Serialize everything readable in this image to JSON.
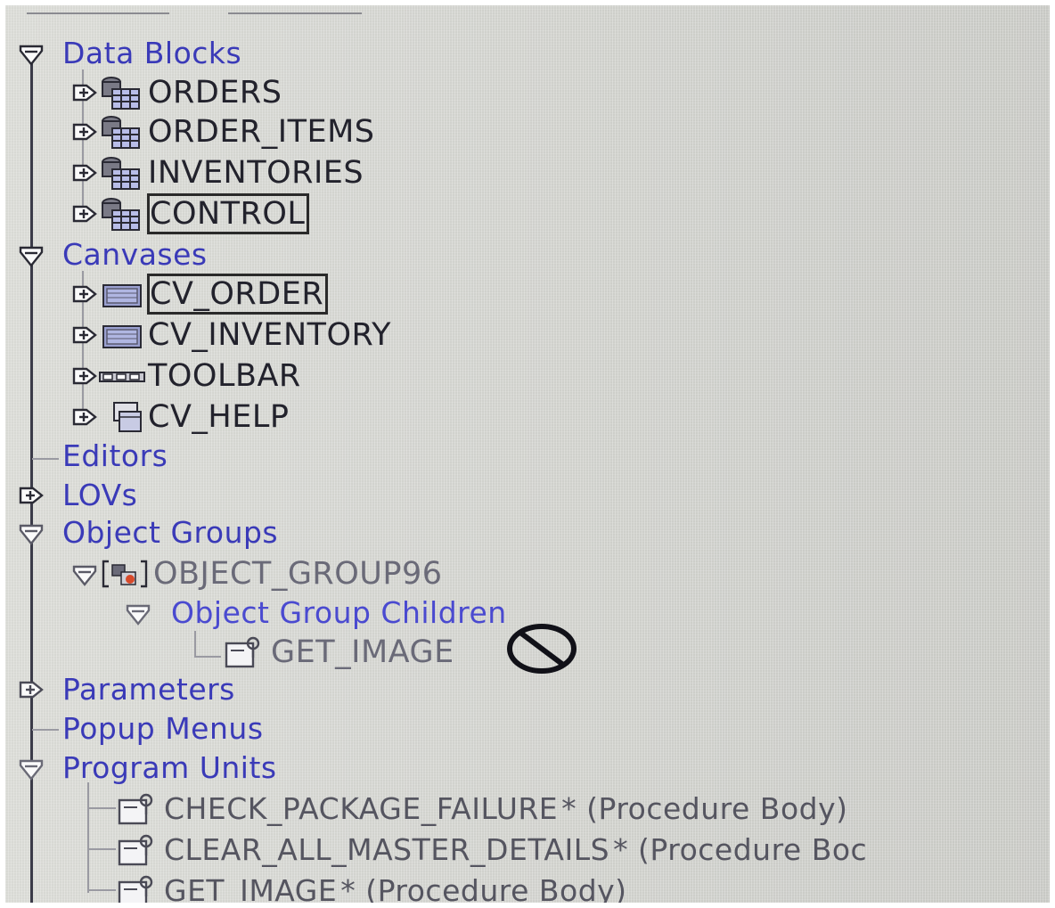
{
  "navigator": {
    "data_blocks": {
      "label": "Data Blocks",
      "items": [
        {
          "label": "ORDERS",
          "icon": "data-block-icon"
        },
        {
          "label": "ORDER_ITEMS",
          "icon": "data-block-icon"
        },
        {
          "label": "INVENTORIES",
          "icon": "data-block-icon"
        },
        {
          "label": "CONTROL",
          "icon": "data-block-icon"
        }
      ]
    },
    "canvases": {
      "label": "Canvases",
      "items": [
        {
          "label": "CV_ORDER",
          "icon": "content-canvas-icon"
        },
        {
          "label": "CV_INVENTORY",
          "icon": "content-canvas-icon"
        },
        {
          "label": "TOOLBAR",
          "icon": "toolbar-canvas-icon"
        },
        {
          "label": "CV_HELP",
          "icon": "stacked-canvas-icon"
        }
      ]
    },
    "editors": {
      "label": "Editors"
    },
    "lovs": {
      "label": "LOVs"
    },
    "object_groups": {
      "label": "Object Groups",
      "group": {
        "label": "OBJECT_GROUP96",
        "icon": "object-group-icon",
        "children_label": "Object Group Children",
        "child": {
          "label": "GET_IMAGE",
          "icon": "program-unit-icon"
        }
      }
    },
    "parameters": {
      "label": "Parameters"
    },
    "popup_menus": {
      "label": "Popup Menus"
    },
    "program_units": {
      "label": "Program Units",
      "items": [
        {
          "name": "CHECK_PACKAGE_FAILURE",
          "type": "* (Procedure Body)",
          "icon": "program-unit-icon"
        },
        {
          "name": "CLEAR_ALL_MASTER_DETAILS",
          "type": "* (Procedure Boc",
          "icon": "program-unit-icon"
        },
        {
          "name": "GET_IMAGE",
          "type": "* (Procedure Body)",
          "icon": "program-unit-icon"
        }
      ]
    }
  },
  "cursor": {
    "icon": "no-drop-cursor-icon"
  },
  "colors": {
    "background": "#d8d9d4",
    "category_text": "#3a3ab8",
    "item_text": "#22222c",
    "tree_line": "#3a3a48"
  }
}
